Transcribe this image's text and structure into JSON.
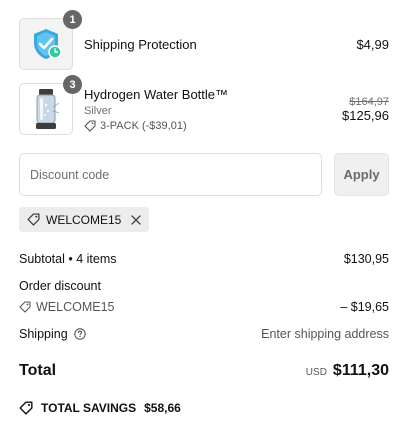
{
  "items": [
    {
      "quantity": "1",
      "name": "Shipping Protection",
      "price": "$4,99",
      "image_icon": "shield-check-icon"
    },
    {
      "quantity": "3",
      "name": "Hydrogen Water Bottle™",
      "variant": "Silver",
      "discount": "3-PACK (-$39,01)",
      "original_price": "$164,97",
      "price": "$125,96",
      "image_icon": "water-bottle-icon"
    }
  ],
  "discount": {
    "placeholder": "Discount code",
    "apply_label": "Apply",
    "applied_code": "WELCOME15"
  },
  "summary": {
    "subtotal_label": "Subtotal • 4 items",
    "subtotal_value": "$130,95",
    "order_discount_label": "Order discount",
    "order_discount_code": "WELCOME15",
    "order_discount_value": "– $19,65",
    "shipping_label": "Shipping",
    "shipping_value": "Enter shipping address",
    "total_label": "Total",
    "currency": "USD",
    "total_value": "$111,30",
    "savings_label": "TOTAL SAVINGS",
    "savings_value": "$58,66"
  },
  "colors": {
    "shield": "#3aa7e0",
    "badge": "#666666",
    "chip_bg": "#ececec"
  }
}
